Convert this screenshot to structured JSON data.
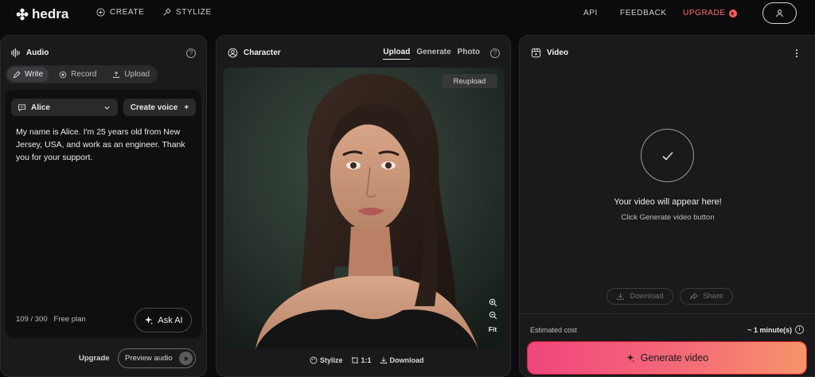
{
  "brand": {
    "name": "hedra"
  },
  "nav": {
    "create": "CREATE",
    "stylize": "STYLIZE",
    "api": "API",
    "feedback": "FEEDBACK",
    "upgrade": "UPGRADE"
  },
  "audio": {
    "title": "Audio",
    "modes": [
      "Write",
      "Record",
      "Upload"
    ],
    "active_mode": "Write",
    "voice": "Alice",
    "create_voice": "Create voice",
    "script": "My name is Alice. I'm 25 years old from New Jersey, USA, and work as an engineer. Thank you for your support.",
    "counter": "109 / 300",
    "plan": "Free plan",
    "ask_ai": "Ask AI",
    "upgrade": "Upgrade",
    "preview": "Preview audio"
  },
  "character": {
    "title": "Character",
    "tabs": [
      "Upload",
      "Generate",
      "Photo"
    ],
    "active_tab": "Upload",
    "reupload": "Reupload",
    "fit": "Fit",
    "actions": {
      "stylize": "Stylize",
      "ratio": "1:1",
      "download": "Download"
    }
  },
  "video": {
    "title": "Video",
    "placeholder_title": "Your video will appear here!",
    "placeholder_sub": "Click Generate video button",
    "download": "Download",
    "share": "Share",
    "estimated_cost_label": "Estimated cost",
    "estimated_cost_value": "~ 1 minute(s)",
    "generate": "Generate video"
  },
  "colors": {
    "accent_gradient_start": "#f0467d",
    "accent_gradient_end": "#f7946a",
    "upgrade_red": "#ff6b6b"
  }
}
